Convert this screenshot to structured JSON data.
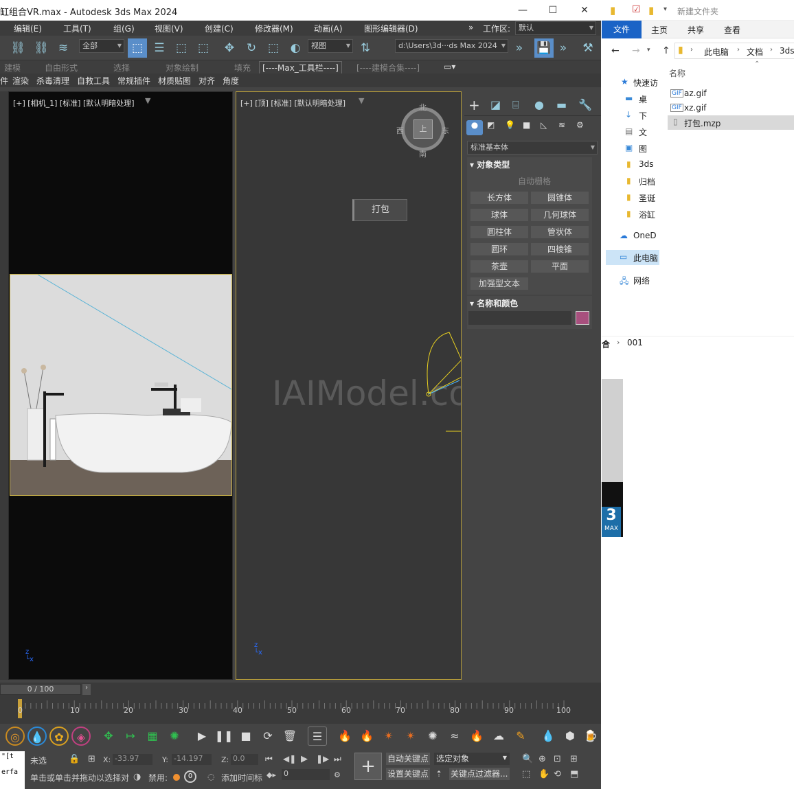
{
  "max": {
    "title": "缸组合VR.max - Autodesk 3ds Max 2024",
    "menus": [
      "编辑(E)",
      "工具(T)",
      "组(G)",
      "视图(V)",
      "创建(C)",
      "修改器(M)",
      "动画(A)",
      "图形编辑器(D)"
    ],
    "workspace_label": "工作区:",
    "workspace_value": "默认",
    "selection_filter": "全部",
    "ref_coord": "视图",
    "path": "d:\\Users\\3d···ds Max 2024",
    "ribbon_tabs": [
      "建模",
      "自由形式",
      "选择",
      "对象绘制",
      "填充",
      "[----Max_工具栏----]",
      "[----建模合集----]"
    ],
    "tool_tabs": [
      "件",
      "渲染",
      "杀毒清理",
      "自救工具",
      "常规插件",
      "材质贴图",
      "对齐",
      "角度"
    ],
    "viewport_left_label": "[+] [相机_1] [标准] [默认明暗处理]",
    "viewport_right_label": "[+] [顶] [标准] [默认明暗处理]",
    "viewcube": {
      "north": "北",
      "south": "南",
      "west": "西",
      "east": "东",
      "face": "上"
    },
    "pack_button": "打包",
    "watermark": "IAIModel.com",
    "cmd": {
      "dropdown": "标准基本体",
      "rollout_object_type": "对象类型",
      "autogrid": "自动栅格",
      "objects": [
        "长方体",
        "圆锥体",
        "球体",
        "几何球体",
        "圆柱体",
        "管状体",
        "圆环",
        "四棱锥",
        "茶壶",
        "平面",
        "加强型文本"
      ],
      "rollout_name_color": "名称和颜色",
      "color_swatch": "#a8507e"
    },
    "timeslider": "0 / 100",
    "ticks": [
      "0",
      "10",
      "20",
      "30",
      "40",
      "50",
      "60",
      "70",
      "80",
      "90",
      "100"
    ],
    "status": {
      "none_selected": "未选",
      "prompt": "单击或单击并拖动以选择对",
      "x_label": "X:",
      "x_value": "-33.97",
      "y_label": "Y:",
      "y_value": "-14.197",
      "z_label": "Z:",
      "z_value": "0.0",
      "disable_label": "禁用:",
      "add_time_tag": "添加时间标",
      "autokey": "自动关键点",
      "selected_object": "选定对象",
      "set_key": "设置关键点",
      "key_filters": "关键点过滤器...",
      "frame": "0",
      "script1": "\"[t",
      "script2": "erfa"
    }
  },
  "explorer": {
    "title": "新建文件夹",
    "tabs": [
      "文件",
      "主页",
      "共享",
      "查看"
    ],
    "breadcrumb": [
      "此电脑",
      "文档",
      "3ds"
    ],
    "nav": [
      "快速访",
      "桌",
      "下",
      "文",
      "图",
      "3ds",
      "归档",
      "圣诞",
      "浴缸",
      "OneD",
      "此电脑",
      "网络"
    ],
    "column_name": "名称",
    "files": [
      "az.gif",
      "xz.gif",
      "打包.mzp"
    ],
    "bottom_crumb": [
      "合",
      "001"
    ],
    "logo_text": "3",
    "logo_sub": "MAX"
  }
}
